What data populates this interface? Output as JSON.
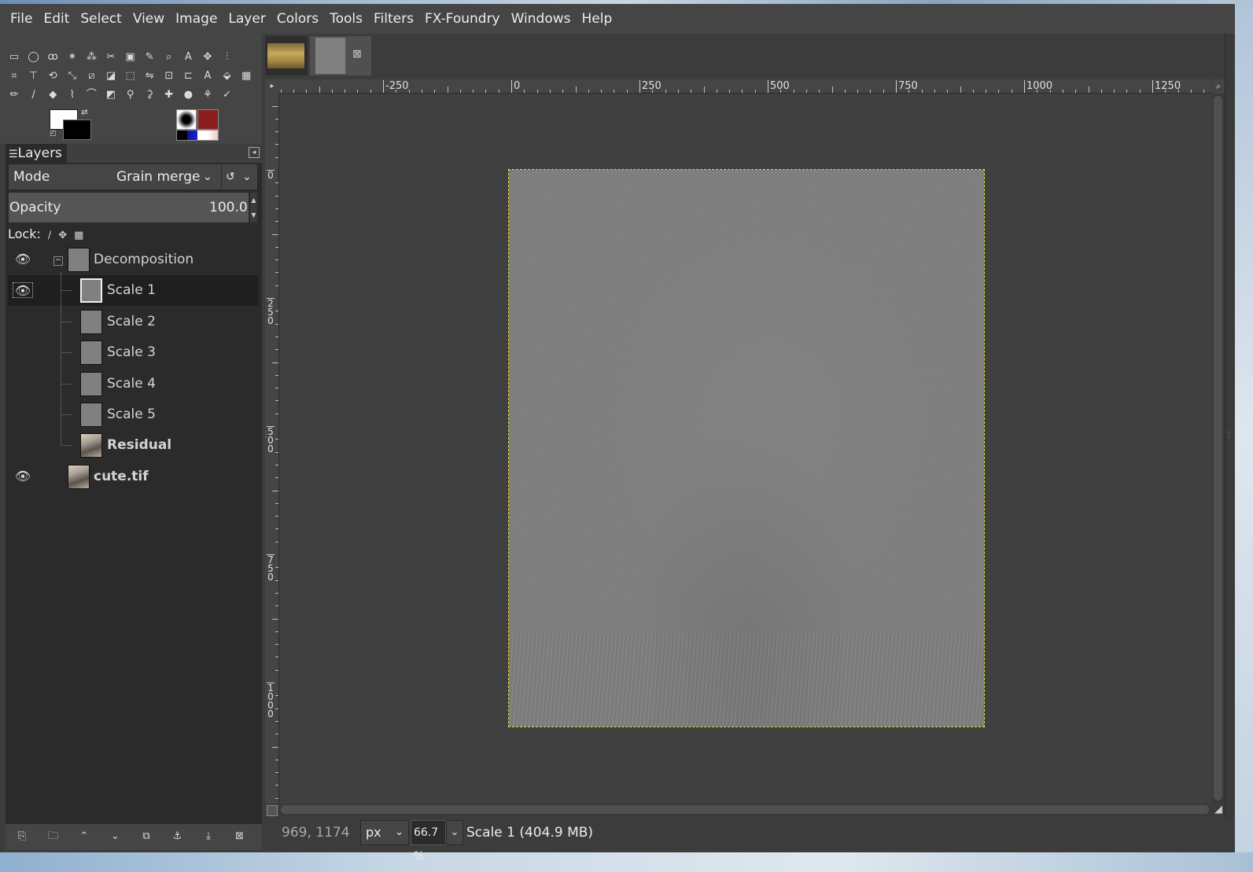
{
  "menubar": {
    "items": [
      "File",
      "Edit",
      "Select",
      "View",
      "Image",
      "Layer",
      "Colors",
      "Tools",
      "Filters",
      "FX-Foundry",
      "Windows",
      "Help"
    ]
  },
  "toolbox": {
    "rows": [
      [
        "rect-select-icon",
        "ellipse-select-icon",
        "free-select-icon",
        "fuzzy-select-icon",
        "color-select-icon",
        "scissors-icon",
        "foreground-select-icon",
        "color-picker-icon",
        "zoom-icon",
        "measure-icon",
        "move-icon",
        "align-icon"
      ],
      [
        "crop-icon",
        "transform-icon",
        "rotate-icon",
        "scale-icon",
        "shear-icon",
        "perspective-icon",
        "3d-transform-icon",
        "flip-icon",
        "cage-icon",
        "warp-icon",
        "text-icon",
        "bucket-fill-icon",
        "gradient-icon"
      ],
      [
        "pencil-icon",
        "paintbrush-icon",
        "eraser-icon",
        "airbrush-icon",
        "ink-icon",
        "mypaint-brush-icon",
        "clone-icon",
        "perspective-clone-icon",
        "heal-icon",
        "blur-icon",
        "smudge-icon",
        "dodge-burn-icon"
      ]
    ],
    "glyphs": [
      [
        "▭",
        "◯",
        "ꝏ",
        "✶",
        "⁂",
        "✂",
        "▣",
        "✎",
        "⌕",
        "A",
        "✥",
        "⫶"
      ],
      [
        "⌗",
        "⊤",
        "⟲",
        "⤡",
        "⧄",
        "◪",
        "⬚",
        "⇋",
        "⊡",
        "⊏",
        "A",
        "⬙",
        "▦"
      ],
      [
        "✏",
        "∕",
        "◆",
        "⌇",
        "⌒",
        "◩",
        "⚲",
        "⚳",
        "✚",
        "●",
        "⚘",
        "✓"
      ]
    ],
    "colors": {
      "foreground": "#ffffff",
      "background": "#000000"
    }
  },
  "layers_panel": {
    "tab_label": "Layers",
    "mode": {
      "label": "Mode",
      "value": "Grain merge"
    },
    "opacity": {
      "label": "Opacity",
      "value": "100.0"
    },
    "lock_label": "Lock:",
    "layers": [
      {
        "name": "Decomposition",
        "visible": true,
        "level": 0,
        "group": true,
        "selected": false,
        "bold": false,
        "thumb": "gray"
      },
      {
        "name": "Scale 1",
        "visible": true,
        "level": 1,
        "group": false,
        "selected": true,
        "bold": false,
        "thumb": "gray"
      },
      {
        "name": "Scale 2",
        "visible": false,
        "level": 1,
        "group": false,
        "selected": false,
        "bold": false,
        "thumb": "gray"
      },
      {
        "name": "Scale 3",
        "visible": false,
        "level": 1,
        "group": false,
        "selected": false,
        "bold": false,
        "thumb": "gray"
      },
      {
        "name": "Scale 4",
        "visible": false,
        "level": 1,
        "group": false,
        "selected": false,
        "bold": false,
        "thumb": "gray"
      },
      {
        "name": "Scale 5",
        "visible": false,
        "level": 1,
        "group": false,
        "selected": false,
        "bold": false,
        "thumb": "gray"
      },
      {
        "name": "Residual",
        "visible": false,
        "level": 1,
        "group": false,
        "selected": false,
        "bold": true,
        "thumb": "photo"
      },
      {
        "name": "cute.tif",
        "visible": true,
        "level": 0,
        "group": false,
        "selected": false,
        "bold": true,
        "thumb": "photo"
      }
    ],
    "bottom_buttons": [
      "new-layer-icon",
      "new-group-icon",
      "raise-layer-icon",
      "lower-layer-icon",
      "duplicate-layer-icon",
      "anchor-layer-icon",
      "merge-down-icon",
      "delete-layer-icon"
    ],
    "bottom_glyphs": [
      "⎘",
      "🗀",
      "⌃",
      "⌄",
      "⧉",
      "⚓",
      "⤓",
      "⊠"
    ]
  },
  "ruler": {
    "h_labels": [
      "-250",
      "0",
      "250",
      "500",
      "750",
      "1000",
      "1250"
    ],
    "v_labels": [
      "0",
      "250",
      "500",
      "750",
      "1000"
    ]
  },
  "statusbar": {
    "coords": "969, 1174",
    "unit": "px",
    "zoom": "66.7 %",
    "message": "Scale 1 (404.9 MB)"
  }
}
